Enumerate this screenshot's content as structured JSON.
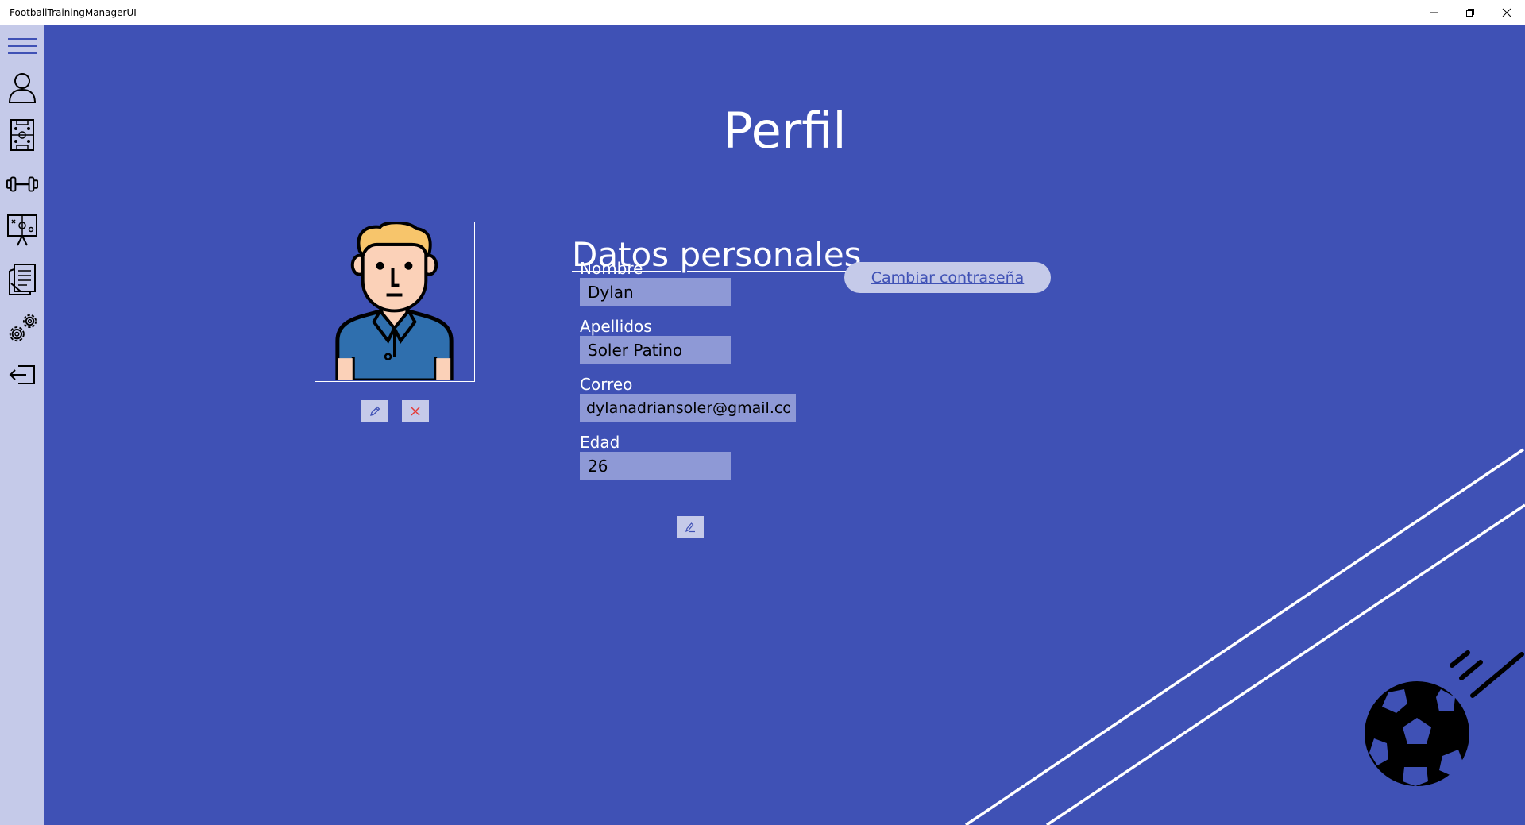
{
  "window": {
    "title": "FootballTrainingManagerUI"
  },
  "sidebar": {
    "items": [
      {
        "icon": "hamburger-menu-icon"
      },
      {
        "icon": "user-profile-icon"
      },
      {
        "icon": "tactics-board-icon"
      },
      {
        "icon": "dumbbell-icon"
      },
      {
        "icon": "training-presentation-icon"
      },
      {
        "icon": "notes-document-icon"
      },
      {
        "icon": "settings-gears-icon"
      },
      {
        "icon": "logout-icon"
      }
    ]
  },
  "page": {
    "title": "Perfil"
  },
  "profile": {
    "section_title": "Datos personales",
    "fields": [
      {
        "label": "Nombre",
        "value": "Dylan"
      },
      {
        "label": "Apellidos",
        "value": "Soler Patino"
      },
      {
        "label": "Correo",
        "value": "dylanadriansoler@gmail.com"
      },
      {
        "label": "Edad",
        "value": "26"
      }
    ],
    "change_password_label": "Cambiar contraseña"
  },
  "colors": {
    "background": "#3f51b5",
    "sidebar": "#c5cae9",
    "input": "#8e99d6",
    "delete": "#e53935"
  }
}
